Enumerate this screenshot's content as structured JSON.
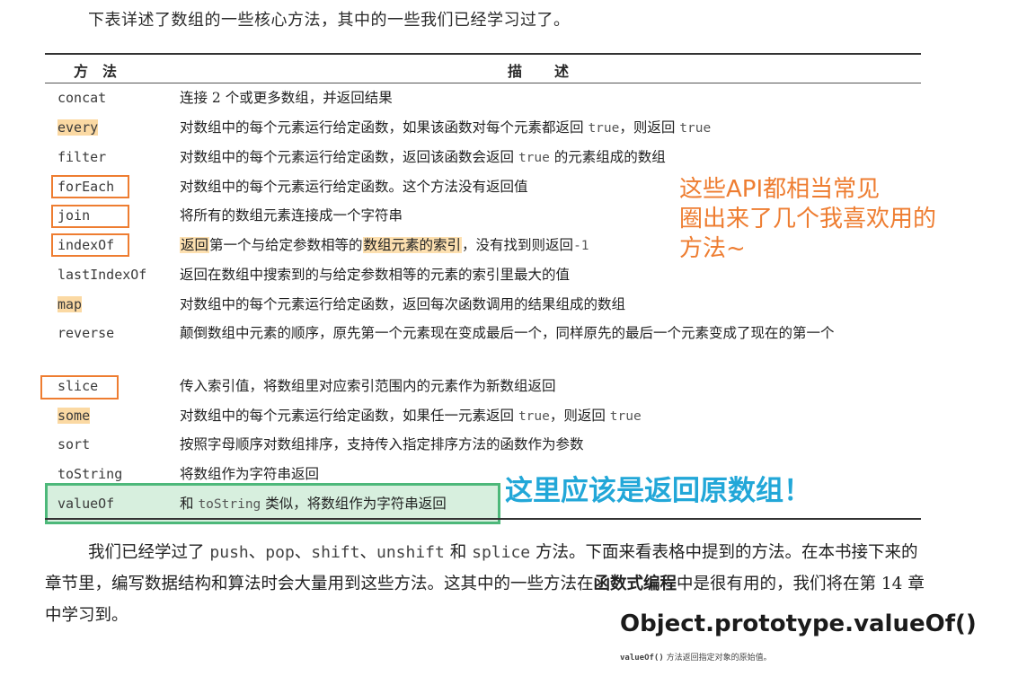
{
  "intro": "下表详述了数组的一些核心方法，其中的一些我们已经学习过了。",
  "table": {
    "header_method": "方法",
    "header_desc": "描述",
    "rows": [
      {
        "name": "concat",
        "desc": "连接 2 个或更多数组，并返回结果"
      },
      {
        "name": "every",
        "desc_a": "对数组中的每个元素运行给定函数，如果该函数对每个元素都返回 ",
        "code1": "true",
        "desc_b": "，则返回 ",
        "code2": "true"
      },
      {
        "name": "filter",
        "desc_a": "对数组中的每个元素运行给定函数，返回该函数会返回 ",
        "code1": "true",
        "desc_b": " 的元素组成的数组"
      },
      {
        "name": "forEach",
        "desc": "对数组中的每个元素运行给定函数。这个方法没有返回值"
      },
      {
        "name": "join",
        "desc": "将所有的数组元素连接成一个字符串"
      },
      {
        "name": "indexOf",
        "desc_a": "返回",
        "desc_b": "第一个与给定参数相等的",
        "desc_c": "数组元素的索引",
        "desc_d": "，没有找到则返回",
        "code1": "-1"
      },
      {
        "name": "lastIndexOf",
        "desc": "返回在数组中搜索到的与给定参数相等的元素的索引里最大的值"
      },
      {
        "name": "map",
        "desc": "对数组中的每个元素运行给定函数，返回每次函数调用的结果组成的数组"
      },
      {
        "name": "reverse",
        "desc": "颠倒数组中元素的顺序，原先第一个元素现在变成最后一个，同样原先的最后一个元素变成了现在的第一个"
      },
      {
        "name": "slice",
        "desc": "传入索引值，将数组里对应索引范围内的元素作为新数组返回"
      },
      {
        "name": "some",
        "desc_a": "对数组中的每个元素运行给定函数，如果任一元素返回 ",
        "code1": "true",
        "desc_b": "，则返回 ",
        "code2": "true"
      },
      {
        "name": "sort",
        "desc": "按照字母顺序对数组排序，支持传入指定排序方法的函数作为参数"
      },
      {
        "name": "toString",
        "desc": "将数组作为字符串返回"
      },
      {
        "name": "valueOf",
        "desc_a": "和 ",
        "code1": "toString",
        "desc_b": " 类似，将数组作为字符串返回"
      }
    ]
  },
  "annotations": {
    "orange_note": [
      "这些API都相当常见",
      "圈出来了几个我喜欢用的",
      "方法~"
    ],
    "teal_note": "这里应该是返回原数组！"
  },
  "paragraph": {
    "p1": "我们已经学过了 ",
    "c_push": "push",
    "sep1": "、",
    "c_pop": "pop",
    "sep2": "、",
    "c_shift": "shift",
    "sep3": "、",
    "c_unshift": "unshift",
    "p2": " 和 ",
    "c_splice": "splice",
    "p3": " 方法。下面来看表格中提到的方法。在本书接下来的章节里，编写数据结构和算法时会大量用到这些方法。这其中的一些方法在",
    "strong": "函数式编程",
    "p4": "中是很有用的，我们将在第 14 章中学习到。"
  },
  "mdn": {
    "title": "Object.prototype.valueOf()",
    "sub_code": "valueOf()",
    "sub_text": " 方法返回指定对象的原始值。"
  },
  "colors": {
    "orange_accent": "#ee7d31",
    "teal_accent": "#22a7d8",
    "green_box": "#4db87a",
    "highlight": "#fbd9a3"
  }
}
